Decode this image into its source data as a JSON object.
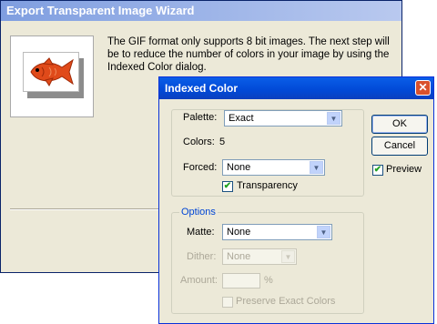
{
  "wizard": {
    "title": "Export Transparent Image Wizard",
    "message": "The GIF format only supports 8 bit images. The next step will be to reduce the number of colors in your image by using the Indexed Color dialog."
  },
  "dialog": {
    "title": "Indexed Color",
    "close_glyph": "✕",
    "palette_label": "Palette:",
    "palette_value": "Exact",
    "colors_label": "Colors:",
    "colors_value": "5",
    "forced_label": "Forced:",
    "forced_value": "None",
    "transparency_label": "Transparency",
    "transparency_checked": true,
    "options_legend": "Options",
    "matte_label": "Matte:",
    "matte_value": "None",
    "dither_label": "Dither:",
    "dither_value": "None",
    "amount_label": "Amount:",
    "amount_unit": "%",
    "preserve_label": "Preserve Exact Colors",
    "preserve_checked": false,
    "ok_label": "OK",
    "cancel_label": "Cancel",
    "preview_label": "Preview",
    "preview_checked": true,
    "check_glyph": "✔",
    "arrow_glyph": "▼"
  },
  "colors": {
    "title_bar": "#0a5ee8",
    "legend_text": "#0046d5",
    "fish": "#e04a1a"
  }
}
